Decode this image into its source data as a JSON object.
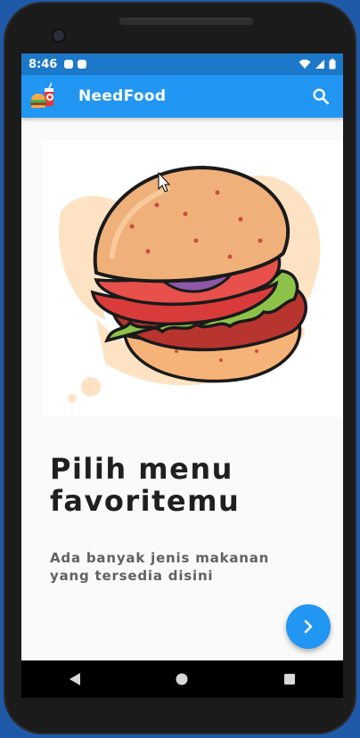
{
  "status_bar": {
    "time": "8:46"
  },
  "app_bar": {
    "title": "NeedFood"
  },
  "onboarding": {
    "headline_line1": "Pilih menu",
    "headline_line2": "favoritemu",
    "subtitle_line1": "Ada banyak jenis makanan",
    "subtitle_line2": "yang tersedia disini"
  },
  "colors": {
    "primary": "#2196f3",
    "status_bar": "#1c78c9",
    "headline": "#1f1f1f",
    "subtitle": "#616161"
  },
  "icons": {
    "logo": "burger-drink-logo-icon",
    "search": "search-icon",
    "next": "chevron-right-icon",
    "nav_back": "back-triangle-icon",
    "nav_home": "home-circle-icon",
    "nav_recents": "recents-square-icon"
  }
}
